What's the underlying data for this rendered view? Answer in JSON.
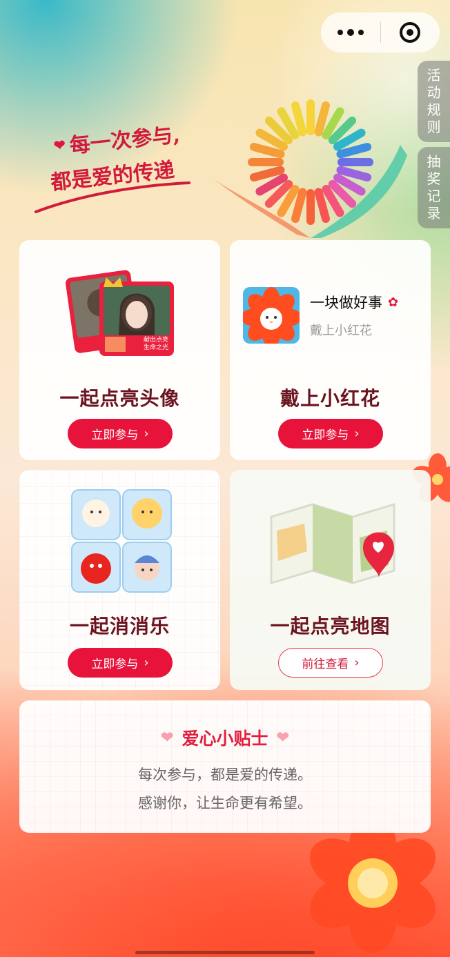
{
  "capsule": {
    "more_icon": "more-dots-icon",
    "close_icon": "target-close-icon"
  },
  "side_tabs": [
    {
      "label": [
        "活",
        "动",
        "规",
        "则"
      ]
    },
    {
      "label": [
        "抽",
        "奖",
        "记",
        "录"
      ]
    }
  ],
  "hero": {
    "slogan_line1": "每一次参与,",
    "slogan_line2": "都是爱的传递"
  },
  "cards": [
    {
      "title": "一起点亮头像",
      "button": "立即参与",
      "button_style": "primary",
      "illustration": {
        "frame_caption": [
          "献出点亮",
          "生命之光"
        ]
      }
    },
    {
      "title": "戴上小红花",
      "button": "立即参与",
      "button_style": "primary",
      "profile": {
        "name": "一块做好事",
        "subtitle": "戴上小红花"
      }
    },
    {
      "title": "一起消消乐",
      "button": "立即参与",
      "button_style": "primary"
    },
    {
      "title": "一起点亮地图",
      "button": "前往查看",
      "button_style": "outline"
    }
  ],
  "tips": {
    "title": "爱心小贴士",
    "line1": "每次参与，都是爱的传递。",
    "line2": "感谢你，让生命更有希望。"
  },
  "colors": {
    "primary_red": "#e8133b",
    "title_brown": "#6b1420",
    "tip_red": "#e01e3e"
  }
}
